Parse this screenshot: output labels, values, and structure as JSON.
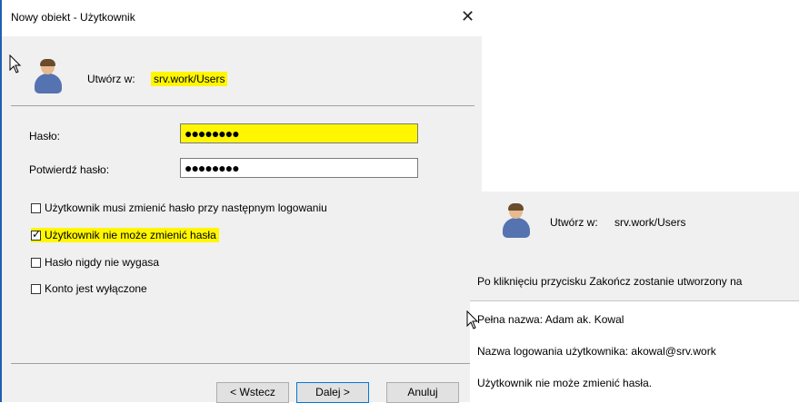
{
  "window": {
    "title": "Nowy obiekt - Użytkownik",
    "close_glyph": "✕"
  },
  "header": {
    "create_in_label": "Utwórz w:",
    "create_in_path": "srv.work/Users"
  },
  "form": {
    "password_label": "Hasło:",
    "password_value": "●●●●●●●●",
    "confirm_label": "Potwierdź hasło:",
    "confirm_value": "●●●●●●●●"
  },
  "options": [
    {
      "label": "Użytkownik musi zmienić hasło przy następnym logowaniu",
      "checked": false
    },
    {
      "label": "Użytkownik nie może zmienić hasła",
      "checked": true
    },
    {
      "label": "Hasło nigdy nie wygasa",
      "checked": false
    },
    {
      "label": "Konto jest wyłączone",
      "checked": false
    }
  ],
  "buttons": {
    "back": "< Wstecz",
    "next": "Dalej >",
    "cancel": "Anuluj"
  },
  "summary": {
    "create_in_label": "Utwórz w:",
    "create_in_path": "srv.work/Users",
    "intro": "Po kliknięciu przycisku Zakończ zostanie utworzony na",
    "lines": [
      "Pełna nazwa: Adam ak. Kowal",
      "Nazwa logowania użytkownika: akowal@srv.work",
      "Użytkownik nie może zmienić hasła."
    ]
  },
  "colors": {
    "highlight": "#fff600",
    "dialog_bg": "#f0f0f0",
    "accent_border": "#0078d7"
  },
  "icons": [
    "user-avatar-icon",
    "close-icon",
    "checkbox-icon",
    "mouse-cursor-icon"
  ]
}
